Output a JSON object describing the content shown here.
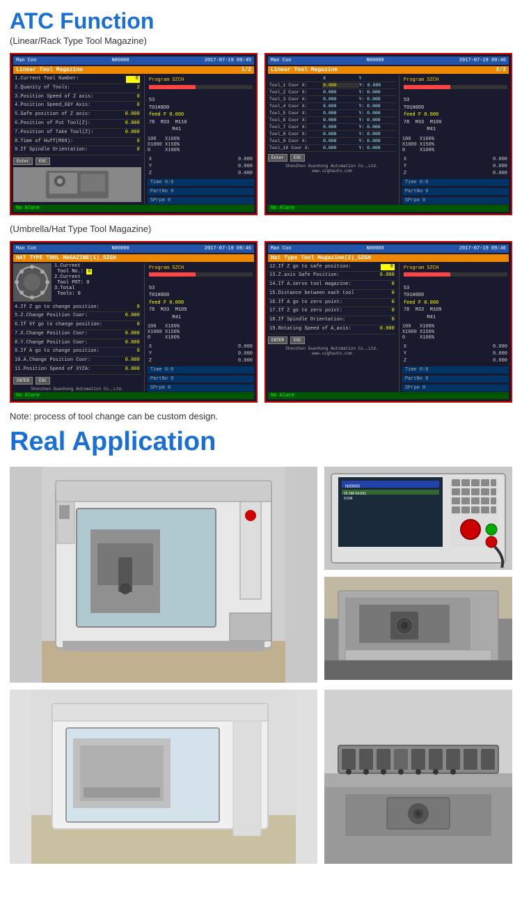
{
  "page": {
    "atc_title": "ATC Function",
    "linear_subtitle": "(Linear/Rack Type Tool Magazine)",
    "umbrella_subtitle": "(Umbrella/Hat Type Tool Magazine)",
    "note": "Note: process of tool change can be custom design.",
    "real_app_title": "Real Application"
  },
  "screens": {
    "linear1": {
      "header_left": "Man  Con",
      "program_number": "N00000",
      "date": "2017-07-19  09:45",
      "title": "Linear Tool Magazine",
      "page": "1/2",
      "rows": [
        {
          "label": "1.Current Tool Number:",
          "value": "0"
        },
        {
          "label": "2.Quanity of Tools:",
          "value": "2"
        },
        {
          "label": "3.Position Speed of Z axis:",
          "value": "0"
        },
        {
          "label": "4.Position Speed_X&Y Axis:",
          "value": "0"
        },
        {
          "label": "5.Safe position of Z axis:",
          "value": "0.000"
        },
        {
          "label": "6.Position of Put Tool(Z):",
          "value": "0.000"
        },
        {
          "label": "7.Position of Take Tool(Z):",
          "value": "0.000"
        },
        {
          "label": "8.Time of Huff(M59):",
          "value": "0"
        },
        {
          "label": "9.If Spindle Orientation:",
          "value": "0"
        }
      ],
      "program": "SZCH",
      "prog_lines": [
        "53",
        "T01H0D0",
        "feed F 0.000",
        "78  M33  M110  M41"
      ],
      "spindle": "X100%",
      "spindle2": "X150%",
      "spindle3": "X100%",
      "coords": {
        "x": "0.000",
        "y": "0.000",
        "z": "0.000"
      },
      "time": "0:0",
      "partno": "0",
      "sprpm": "0",
      "alarm": "No Alarm"
    },
    "linear2": {
      "header_left": "Man  Con",
      "program_number": "N00000",
      "date": "2017-07-19  09:46",
      "title": "Linear Tool Magazine",
      "page": "2/2",
      "tool_rows": [
        {
          "label": "Tool_1 Coor X:",
          "x": "0.000",
          "y": "0.000"
        },
        {
          "label": "Tool_2 Coor X:",
          "x": "0.000",
          "y": "0.000"
        },
        {
          "label": "Tool_3 Coor X:",
          "x": "0.000",
          "y": "0.000"
        },
        {
          "label": "Tool_4 Coor X:",
          "x": "0.000",
          "y": "0.000"
        },
        {
          "label": "Tool_5 Coor X:",
          "x": "0.000",
          "y": "0.000"
        },
        {
          "label": "Tool_6 Coor X:",
          "x": "0.000",
          "y": "0.000"
        },
        {
          "label": "Tool_7 Coor X:",
          "x": "0.000",
          "y": "0.000"
        },
        {
          "label": "Tool_8 Coor X:",
          "x": "0.000",
          "y": "0.000"
        },
        {
          "label": "Tool_9 Coor X:",
          "x": "0.000",
          "y": "0.000"
        },
        {
          "label": "Tool_10 Coor X:",
          "x": "0.000",
          "y": "0.000"
        }
      ],
      "program": "SZCH",
      "prog_lines": [
        "53",
        "T01H0D0",
        "feed F 0.000",
        "78  M33  M109  M41"
      ],
      "spindle": "X100%",
      "spindle2": "X150%",
      "spindle3": "X100%",
      "coords": {
        "x": "0.000",
        "y": "0.000",
        "z": "0.000"
      },
      "time": "0:0",
      "partno": "0",
      "sprpm": "0",
      "alarm": "No Alarm",
      "website": "www.szghauto.com",
      "company": "ShenZhen Guanhong Automation Co.,Ltd."
    },
    "hat1": {
      "header_left": "Man  Con",
      "program_number": "N00000",
      "date": "2017-07-19  09:46",
      "title": "HAT TYPE TOOL MAGAZINE(1)_SZGH",
      "rows": [
        {
          "label": "1.Current",
          "value": ""
        },
        {
          "label": "Tool No.:",
          "value": "0"
        },
        {
          "label": "2.Current",
          "value": ""
        },
        {
          "label": "Tool POT:",
          "value": "0"
        },
        {
          "label": "3.Total",
          "value": ""
        },
        {
          "label": "Tools:",
          "value": "0"
        },
        {
          "label": "4.If Z go to change position:",
          "value": "0"
        },
        {
          "label": "5.Z.Change Position Coor:",
          "value": "0.000"
        },
        {
          "label": "6.If XY go to change position:",
          "value": "0"
        },
        {
          "label": "7.X.Change Position Coor:",
          "value": "0.000"
        },
        {
          "label": "8.Y.Change Position Coor:",
          "value": "0.000"
        },
        {
          "label": "9.If A go to change position:",
          "value": "0"
        },
        {
          "label": "10.A.Change Position Coor:",
          "value": "0.000"
        },
        {
          "label": "11.Position Speed of XYZA:",
          "value": "0.000"
        }
      ],
      "program": "SZCH",
      "prog_lines": [
        "53",
        "T01H0D0",
        "feed F 0.000",
        "78  M33  M109  M41"
      ],
      "spindle": "X100%",
      "spindle2": "X150%",
      "spindle3": "X100%",
      "coords": {
        "x": "0.000",
        "y": "0.000",
        "z": "0.000"
      },
      "time": "0:0",
      "partno": "0",
      "sprpm": "0",
      "alarm": "No Alarm",
      "company": "Shenzhen Guanhong Automation Co.,Ltd."
    },
    "hat2": {
      "header_left": "Man  Con",
      "program_number": "N00000",
      "date": "2017-07-19  09:46",
      "title": "Hat Type Tool Magazine(2)_SZGH",
      "rows": [
        {
          "label": "12.If Z go to safe position:",
          "value": "0"
        },
        {
          "label": "13.Z.axis Safe Position:",
          "value": "0.000"
        },
        {
          "label": "14.If A.servo tool magazine:",
          "value": "0"
        },
        {
          "label": "15.Distance between each tool",
          "value": "0"
        },
        {
          "label": "16.If A go to zero point:",
          "value": "0"
        },
        {
          "label": "17.If Z go to zero point:",
          "value": "0"
        },
        {
          "label": "18.If Spindle Orientation:",
          "value": "0"
        },
        {
          "label": "19.Rotating Speed of A_axis:",
          "value": "0.000"
        }
      ],
      "program": "SZCH",
      "prog_lines": [
        "53",
        "T01H0D0",
        "feed F 0.000",
        "78  M33  M109  M41"
      ],
      "spindle": "X100%",
      "spindle2": "X150%",
      "spindle3": "X100%",
      "coords": {
        "x": "0.000",
        "y": "0.000",
        "z": "0.000"
      },
      "time": "0:0",
      "partno": "0",
      "sprpm": "0",
      "alarm": "No Alarm",
      "website": "www.szghauto.com",
      "company": "Shenzhen Guanhong Automation Co.,Ltd."
    }
  },
  "buttons": {
    "enter": "Enter",
    "esc": "ESC"
  }
}
